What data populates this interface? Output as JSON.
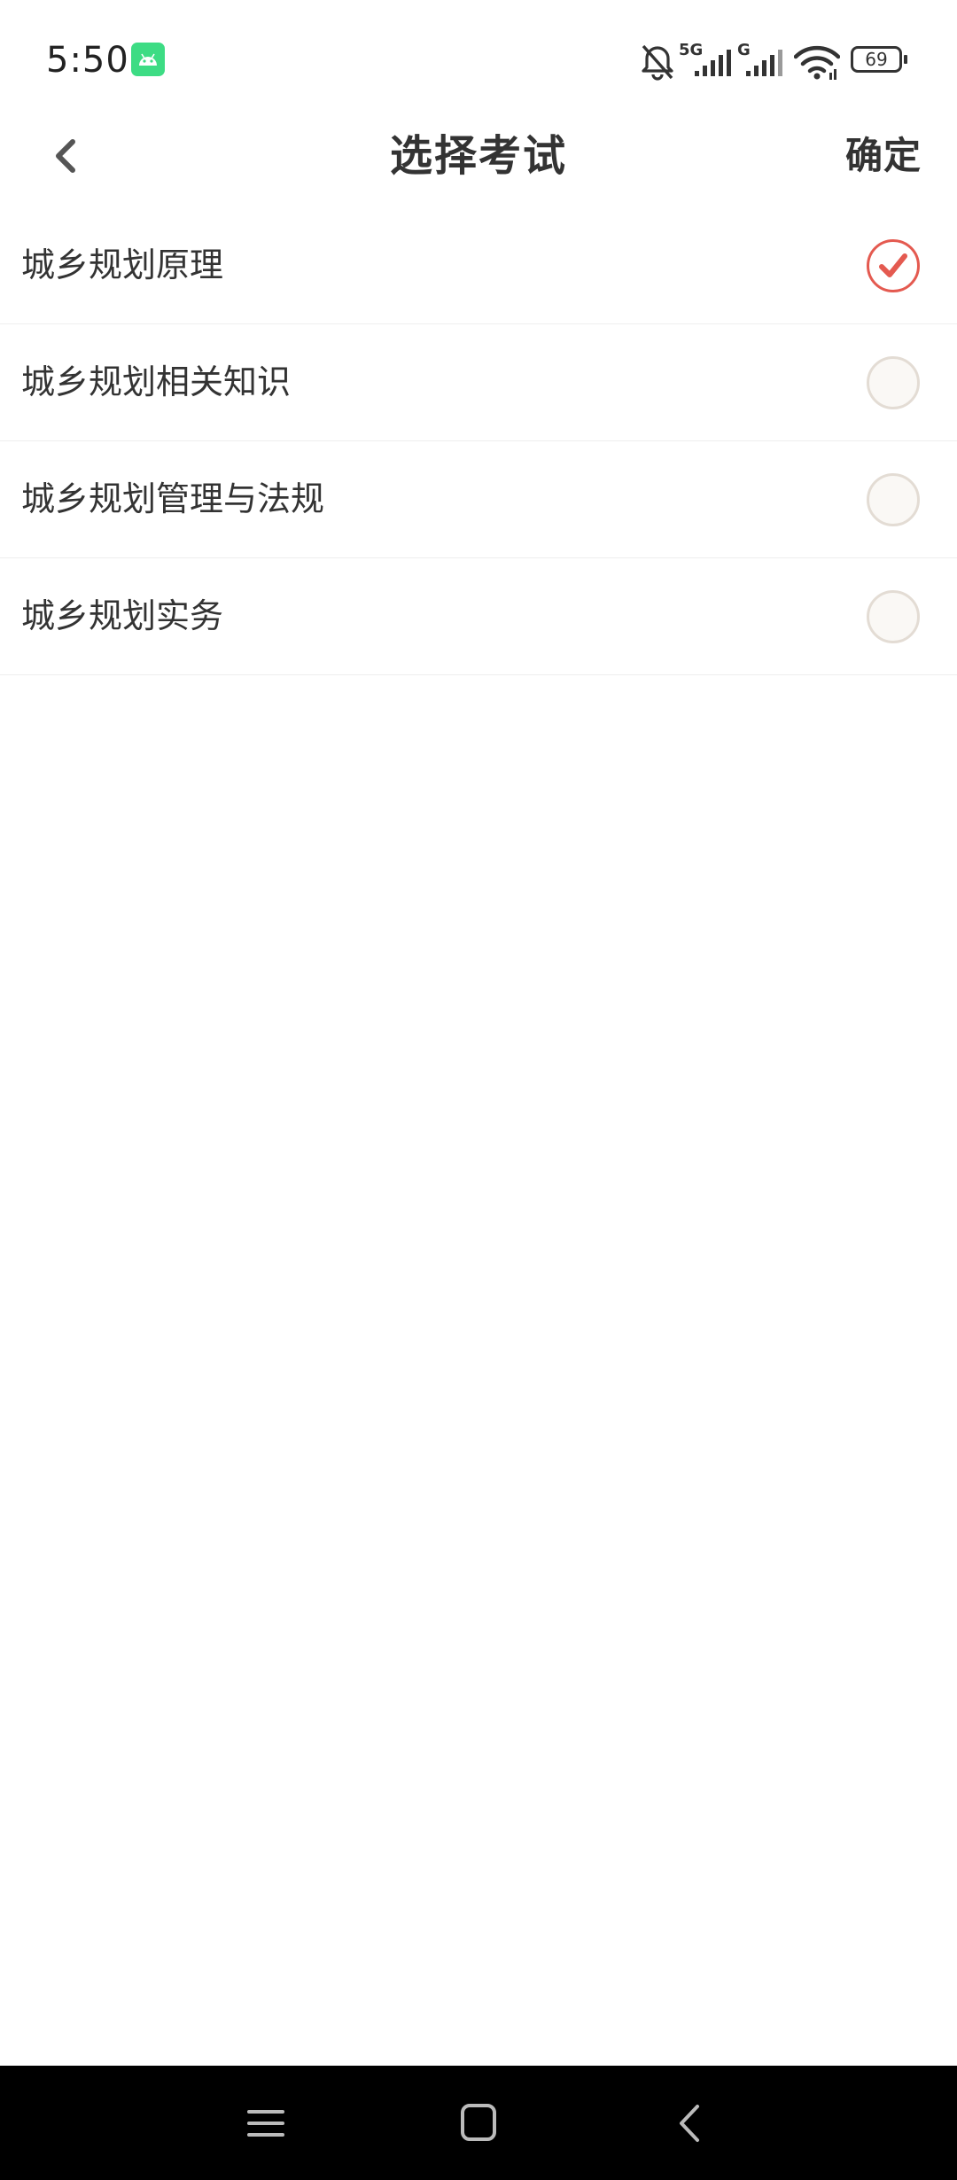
{
  "status_bar": {
    "time": "5:50",
    "battery": "69",
    "icons": [
      "app-badge-icon",
      "mute-bell-icon",
      "signal-5g-icon",
      "signal-g-icon",
      "wifi-icon",
      "battery-icon"
    ]
  },
  "header": {
    "title": "选择考试",
    "confirm_label": "确定",
    "back_icon": "chevron-left-icon"
  },
  "exams": [
    {
      "label": "城乡规划原理",
      "selected": true
    },
    {
      "label": "城乡规划相关知识",
      "selected": false
    },
    {
      "label": "城乡规划管理与法规",
      "selected": false
    },
    {
      "label": "城乡规划实务",
      "selected": false
    }
  ],
  "colors": {
    "accent": "#e45a50",
    "unselected_border": "#e3dcd4",
    "nav_bar": "#000000"
  },
  "nav_bar": {
    "icons": [
      "menu-icon",
      "home-icon",
      "back-icon"
    ]
  }
}
